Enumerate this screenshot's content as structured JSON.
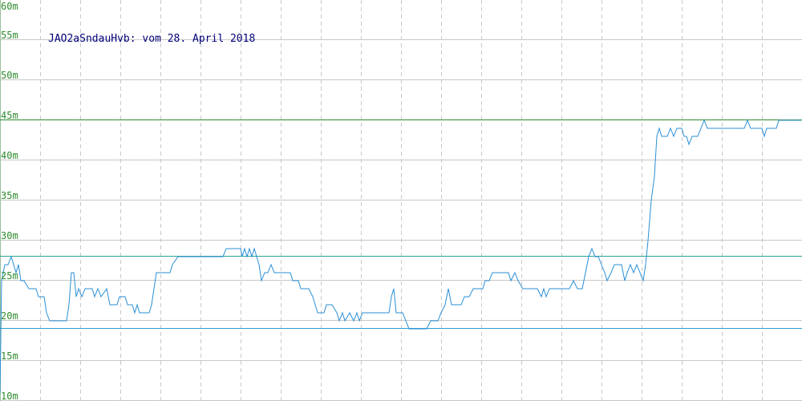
{
  "chart_data": {
    "type": "line",
    "title": "JAO2aSndauHvb: vom 28. April 2018",
    "xlabel": "",
    "ylabel": "",
    "ylim": [
      10,
      60
    ],
    "y_ticks": [
      "10m",
      "15m",
      "20m",
      "25m",
      "30m",
      "35m",
      "40m",
      "45m",
      "50m",
      "55m",
      "60m"
    ],
    "y_tick_values": [
      10,
      15,
      20,
      25,
      30,
      35,
      40,
      45,
      50,
      55,
      60
    ],
    "grid": true,
    "x_range": [
      0,
      1000
    ],
    "x_grid_count": 20,
    "reference_lines": [
      {
        "value": 45,
        "color": "#2e8b2e"
      },
      {
        "value": 28,
        "color": "#2aa198"
      },
      {
        "value": 19,
        "color": "#2a9fd6"
      }
    ],
    "series": [
      {
        "color": "#2a8fd6",
        "points": [
          [
            0,
            11
          ],
          [
            2,
            25
          ],
          [
            6,
            27
          ],
          [
            10,
            27
          ],
          [
            14,
            28
          ],
          [
            17,
            27
          ],
          [
            20,
            26
          ],
          [
            23,
            27
          ],
          [
            26,
            25
          ],
          [
            30,
            25
          ],
          [
            36,
            24
          ],
          [
            45,
            24
          ],
          [
            48,
            23
          ],
          [
            55,
            23
          ],
          [
            58,
            21
          ],
          [
            62,
            20
          ],
          [
            75,
            20
          ],
          [
            83,
            20
          ],
          [
            86,
            22
          ],
          [
            89,
            26
          ],
          [
            92,
            26
          ],
          [
            95,
            23
          ],
          [
            98,
            24
          ],
          [
            102,
            23
          ],
          [
            106,
            24
          ],
          [
            115,
            24
          ],
          [
            118,
            23
          ],
          [
            122,
            24
          ],
          [
            126,
            23
          ],
          [
            133,
            24
          ],
          [
            137,
            22
          ],
          [
            146,
            22
          ],
          [
            149,
            23
          ],
          [
            156,
            23
          ],
          [
            159,
            22
          ],
          [
            165,
            22
          ],
          [
            168,
            21
          ],
          [
            171,
            22
          ],
          [
            174,
            21
          ],
          [
            186,
            21
          ],
          [
            189,
            22
          ],
          [
            192,
            24
          ],
          [
            195,
            26
          ],
          [
            205,
            26
          ],
          [
            212,
            26
          ],
          [
            215,
            27
          ],
          [
            222,
            28
          ],
          [
            240,
            28
          ],
          [
            260,
            28
          ],
          [
            278,
            28
          ],
          [
            282,
            29
          ],
          [
            300,
            29
          ],
          [
            302,
            28
          ],
          [
            305,
            29
          ],
          [
            308,
            28
          ],
          [
            311,
            29
          ],
          [
            314,
            28
          ],
          [
            317,
            29
          ],
          [
            320,
            28
          ],
          [
            323,
            27
          ],
          [
            326,
            25
          ],
          [
            330,
            26
          ],
          [
            334,
            26
          ],
          [
            338,
            27
          ],
          [
            342,
            26
          ],
          [
            350,
            26
          ],
          [
            362,
            26
          ],
          [
            365,
            25
          ],
          [
            372,
            25
          ],
          [
            375,
            24
          ],
          [
            385,
            24
          ],
          [
            390,
            23
          ],
          [
            393,
            22
          ],
          [
            396,
            21
          ],
          [
            404,
            21
          ],
          [
            407,
            22
          ],
          [
            414,
            22
          ],
          [
            420,
            21
          ],
          [
            423,
            20
          ],
          [
            427,
            21
          ],
          [
            430,
            20
          ],
          [
            436,
            21
          ],
          [
            441,
            20
          ],
          [
            445,
            21
          ],
          [
            448,
            20
          ],
          [
            452,
            21
          ],
          [
            462,
            21
          ],
          [
            470,
            21
          ],
          [
            479,
            21
          ],
          [
            485,
            21
          ],
          [
            488,
            23
          ],
          [
            491,
            24
          ],
          [
            494,
            21
          ],
          [
            502,
            21
          ],
          [
            506,
            20
          ],
          [
            510,
            19
          ],
          [
            532,
            19
          ],
          [
            537,
            20
          ],
          [
            546,
            20
          ],
          [
            550,
            21
          ],
          [
            555,
            22
          ],
          [
            559,
            24
          ],
          [
            563,
            22
          ],
          [
            575,
            22
          ],
          [
            579,
            23
          ],
          [
            585,
            23
          ],
          [
            590,
            24
          ],
          [
            602,
            24
          ],
          [
            605,
            25
          ],
          [
            610,
            25
          ],
          [
            614,
            26
          ],
          [
            634,
            26
          ],
          [
            637,
            25
          ],
          [
            642,
            26
          ],
          [
            646,
            25
          ],
          [
            652,
            24
          ],
          [
            670,
            24
          ],
          [
            675,
            23
          ],
          [
            678,
            24
          ],
          [
            681,
            23
          ],
          [
            685,
            24
          ],
          [
            710,
            24
          ],
          [
            715,
            25
          ],
          [
            720,
            24
          ],
          [
            726,
            24
          ],
          [
            730,
            26
          ],
          [
            734,
            28
          ],
          [
            738,
            29
          ],
          [
            742,
            28
          ],
          [
            746,
            28
          ],
          [
            750,
            27
          ],
          [
            754,
            26
          ],
          [
            757,
            25
          ],
          [
            762,
            26
          ],
          [
            766,
            27
          ],
          [
            775,
            27
          ],
          [
            779,
            25
          ],
          [
            782,
            26
          ],
          [
            786,
            27
          ],
          [
            790,
            26
          ],
          [
            794,
            27
          ],
          [
            798,
            26
          ],
          [
            802,
            25
          ],
          [
            805,
            27
          ],
          [
            808,
            30
          ],
          [
            812,
            35
          ],
          [
            816,
            38
          ],
          [
            819,
            43
          ],
          [
            822,
            44
          ],
          [
            825,
            43
          ],
          [
            832,
            43
          ],
          [
            836,
            44
          ],
          [
            840,
            43
          ],
          [
            844,
            44
          ],
          [
            850,
            44
          ],
          [
            853,
            43
          ],
          [
            856,
            43
          ],
          [
            859,
            42
          ],
          [
            863,
            43
          ],
          [
            870,
            43
          ],
          [
            874,
            44
          ],
          [
            878,
            45
          ],
          [
            882,
            44
          ],
          [
            928,
            44
          ],
          [
            932,
            45
          ],
          [
            936,
            44
          ],
          [
            950,
            44
          ],
          [
            953,
            43
          ],
          [
            956,
            44
          ],
          [
            968,
            44
          ],
          [
            971,
            45
          ],
          [
            999,
            45
          ]
        ]
      }
    ]
  }
}
